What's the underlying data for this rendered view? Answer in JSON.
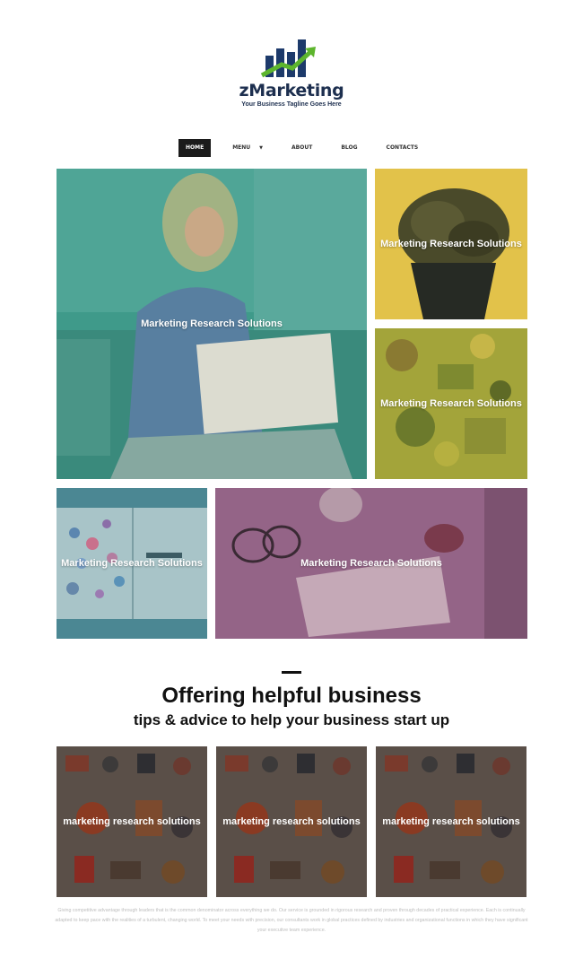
{
  "brand": {
    "name": "zMarketing",
    "tagline": "Your Business Tagline Goes Here",
    "colors": {
      "navy": "#1d3a6b",
      "green": "#5db52d"
    }
  },
  "nav": {
    "items": [
      "HOME",
      "MENU",
      "ABOUT",
      "BLOG",
      "CONTACTS"
    ],
    "active": "HOME"
  },
  "tiles": {
    "main": "Marketing Research Solutions",
    "plant": "Marketing Research Solutions",
    "objects": "Marketing Research Solutions",
    "notebook": "Marketing Research Solutions",
    "desk": "Marketing Research Solutions",
    "colors": {
      "teal": "#3f9a8a",
      "yellow": "#e2c24a",
      "olive": "#a3a43a",
      "steel": "#4b8793",
      "mauve": "#8f5f86"
    }
  },
  "section": {
    "title": "Offering helpful business",
    "subtitle": "tips & advice to help your business start up"
  },
  "gear_tiles": [
    "marketing research solutions",
    "marketing research solutions",
    "marketing research solutions"
  ],
  "description": "Giving competitive advantage through leaders that is the common denominator across everything we do. Our service is grounded in rigorous research and proven through decades of practical experience. Each is continually adapted to keep pace with the realities of a turbulent, changing world. To meet your needs with precision, our consultants work in global practices defined by industries and organizational functions in which they have significant your executive team experience."
}
